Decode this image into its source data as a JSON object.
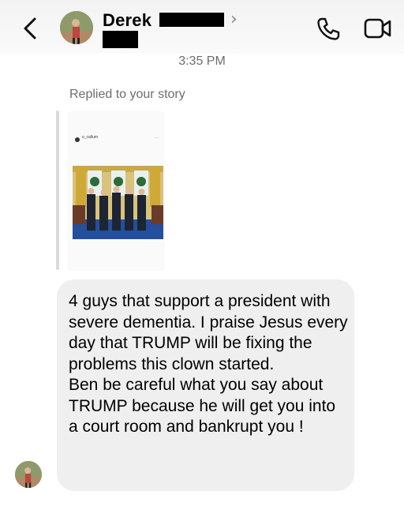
{
  "header": {
    "contact_name": "Derek",
    "icons": {
      "back": "chevron-left-icon",
      "profile_chevron": "chevron-right-icon",
      "call": "phone-icon",
      "video": "video-camera-icon"
    }
  },
  "conversation": {
    "timestamp": "3:35 PM",
    "reply_label": "Replied to your story",
    "story": {
      "handle": "o_callum",
      "more": "···"
    },
    "message_lines": [
      "4 guys that support a president with severe dementia. I praise Jesus every day that TRUMP will be fixing the problems this clown started.",
      "Ben be careful what you say about TRUMP because he will get you into a court room and bankrupt you !"
    ]
  },
  "colors": {
    "bubble": "#efefef",
    "meta_text": "#6d6d6d",
    "header_bg": "#f3f3f3"
  }
}
